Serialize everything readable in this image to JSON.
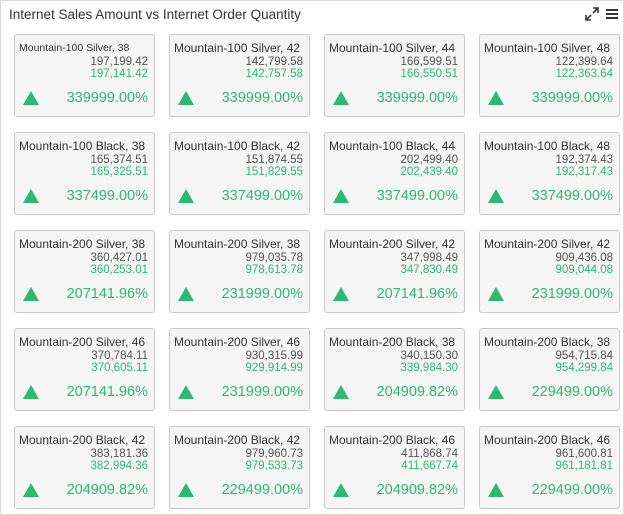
{
  "header": {
    "title": "Internet Sales Amount vs Internet Order Quantity",
    "expand_icon": "expand-arrows-icon",
    "menu_icon": "hamburger-menu-icon"
  },
  "colors": {
    "positive": "#2eb872",
    "card_bg": "#f5f5f5",
    "card_border": "#c9c9c9"
  },
  "cards": [
    {
      "label": "Mountain-100 Silver, 38",
      "actual": "197,199.42",
      "target": "197,141.42",
      "change": "339999.00%",
      "trend": "up"
    },
    {
      "label": "Mountain-100 Silver, 42",
      "actual": "142,799.58",
      "target": "142,757.58",
      "change": "339999.00%",
      "trend": "up"
    },
    {
      "label": "Mountain-100 Silver, 44",
      "actual": "166,599.51",
      "target": "166,550.51",
      "change": "339999.00%",
      "trend": "up"
    },
    {
      "label": "Mountain-100 Silver, 48",
      "actual": "122,399.64",
      "target": "122,363.64",
      "change": "339999.00%",
      "trend": "up"
    },
    {
      "label": "Mountain-100 Black, 38",
      "actual": "165,374.51",
      "target": "165,325.51",
      "change": "337499.00%",
      "trend": "up"
    },
    {
      "label": "Mountain-100 Black, 42",
      "actual": "151,874.55",
      "target": "151,829.55",
      "change": "337499.00%",
      "trend": "up"
    },
    {
      "label": "Mountain-100 Black, 44",
      "actual": "202,499.40",
      "target": "202,439.40",
      "change": "337499.00%",
      "trend": "up"
    },
    {
      "label": "Mountain-100 Black, 48",
      "actual": "192,374.43",
      "target": "192,317.43",
      "change": "337499.00%",
      "trend": "up"
    },
    {
      "label": "Mountain-200 Silver, 38",
      "actual": "360,427.01",
      "target": "360,253.01",
      "change": "207141.96%",
      "trend": "up"
    },
    {
      "label": "Mountain-200 Silver, 38",
      "actual": "979,035.78",
      "target": "978,613.78",
      "change": "231999.00%",
      "trend": "up"
    },
    {
      "label": "Mountain-200 Silver, 42",
      "actual": "347,998.49",
      "target": "347,830.49",
      "change": "207141.96%",
      "trend": "up"
    },
    {
      "label": "Mountain-200 Silver, 42",
      "actual": "909,436.08",
      "target": "909,044.08",
      "change": "231999.00%",
      "trend": "up"
    },
    {
      "label": "Mountain-200 Silver, 46",
      "actual": "370,784.11",
      "target": "370,605.11",
      "change": "207141.96%",
      "trend": "up"
    },
    {
      "label": "Mountain-200 Silver, 46",
      "actual": "930,315.99",
      "target": "929,914.99",
      "change": "231999.00%",
      "trend": "up"
    },
    {
      "label": "Mountain-200 Black, 38",
      "actual": "340,150.30",
      "target": "339,984.30",
      "change": "204909.82%",
      "trend": "up"
    },
    {
      "label": "Mountain-200 Black, 38",
      "actual": "954,715.84",
      "target": "954,299.84",
      "change": "229499.00%",
      "trend": "up"
    },
    {
      "label": "Mountain-200 Black, 42",
      "actual": "383,181.36",
      "target": "382,994.36",
      "change": "204909.82%",
      "trend": "up"
    },
    {
      "label": "Mountain-200 Black, 42",
      "actual": "979,960.73",
      "target": "979,533.73",
      "change": "229499.00%",
      "trend": "up"
    },
    {
      "label": "Mountain-200 Black, 46",
      "actual": "411,868.74",
      "target": "411,667.74",
      "change": "204909.82%",
      "trend": "up"
    },
    {
      "label": "Mountain-200 Black, 46",
      "actual": "961,600.81",
      "target": "961,181.81",
      "change": "229499.00%",
      "trend": "up"
    }
  ]
}
